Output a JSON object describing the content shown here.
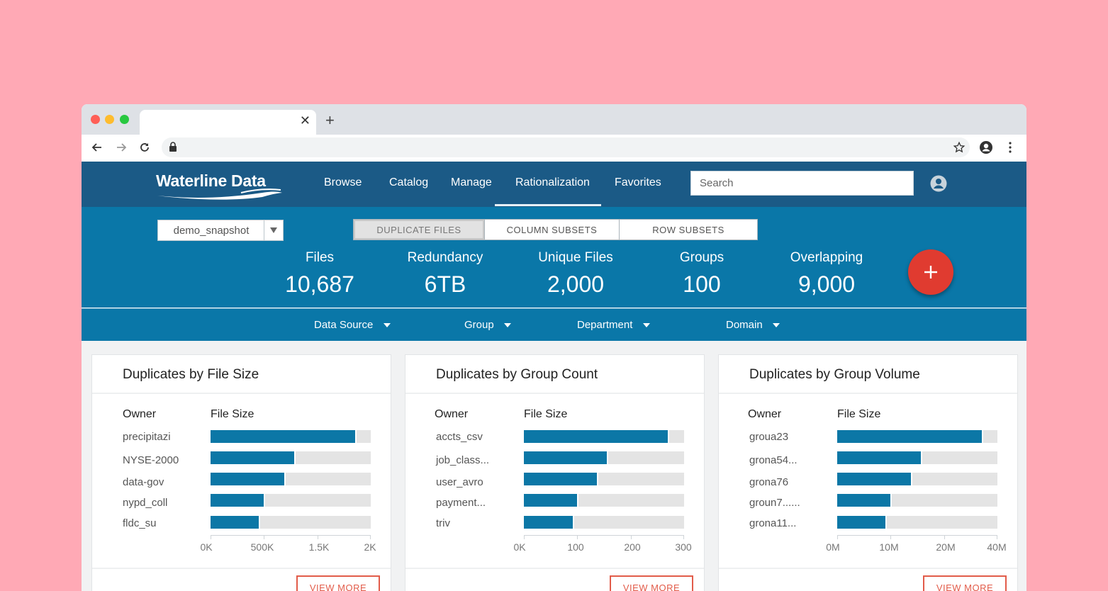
{
  "browser": {
    "tab_title": "",
    "tab_close": "✕",
    "new_tab": "+",
    "url": ""
  },
  "app": {
    "logo_text": "Waterline Data",
    "nav": [
      {
        "label": "Browse"
      },
      {
        "label": "Catalog"
      },
      {
        "label": "Manage"
      },
      {
        "label": "Rationalization",
        "active": true
      },
      {
        "label": "Favorites"
      }
    ],
    "search_placeholder": "Search"
  },
  "summary": {
    "snapshot": "demo_snapshot",
    "segments": [
      {
        "label": "DUPLICATE FILES",
        "active": true
      },
      {
        "label": "COLUMN SUBSETS"
      },
      {
        "label": "ROW SUBSETS"
      }
    ],
    "stats": [
      {
        "label": "Files",
        "value": "10,687"
      },
      {
        "label": "Redundancy",
        "value": "6TB"
      },
      {
        "label": "Unique Files",
        "value": "2,000"
      },
      {
        "label": "Groups",
        "value": "100"
      },
      {
        "label": "Overlapping",
        "value": "9,000"
      }
    ],
    "fab_label": "+"
  },
  "filters": [
    {
      "label": "Data Source"
    },
    {
      "label": "Group"
    },
    {
      "label": "Department"
    },
    {
      "label": "Domain"
    }
  ],
  "cards": [
    {
      "title": "Duplicates by File Size",
      "col_owner": "Owner",
      "col_size": "File Size",
      "rows": [
        {
          "owner": "precipitazi"
        },
        {
          "owner": "NYSE-2000"
        },
        {
          "owner": "data-gov"
        },
        {
          "owner": "nypd_coll"
        },
        {
          "owner": "fldc_su"
        }
      ],
      "ticks": [
        "0K",
        "500K",
        "1.5K",
        "2K"
      ],
      "view_more": "VIEW MORE"
    },
    {
      "title": "Duplicates by Group Count",
      "col_owner": "Owner",
      "col_size": "File Size",
      "rows": [
        {
          "owner": "accts_csv"
        },
        {
          "owner": "job_class..."
        },
        {
          "owner": "user_avro"
        },
        {
          "owner": "payment..."
        },
        {
          "owner": "triv"
        }
      ],
      "ticks": [
        "0K",
        "100",
        "200",
        "300"
      ],
      "view_more": "VIEW MORE"
    },
    {
      "title": "Duplicates by Group Volume",
      "col_owner": "Owner",
      "col_size": "File Size",
      "rows": [
        {
          "owner": "groua23"
        },
        {
          "owner": "grona54..."
        },
        {
          "owner": "grona76"
        },
        {
          "owner": "groun7......"
        },
        {
          "owner": "grona11..."
        }
      ],
      "ticks": [
        "0M",
        "10M",
        "20M",
        "40M"
      ],
      "view_more": "VIEW MORE"
    }
  ],
  "chart_data": [
    {
      "type": "bar",
      "orientation": "horizontal",
      "title": "Duplicates by File Size",
      "xlabel": "File Size",
      "ylabel": "Owner",
      "categories": [
        "precipitazi",
        "NYSE-2000",
        "data-gov",
        "nypd_coll",
        "fldc_su"
      ],
      "fractions": [
        0.91,
        0.53,
        0.47,
        0.34,
        0.31
      ],
      "tick_labels": [
        "0K",
        "500K",
        "1.5K",
        "2K"
      ]
    },
    {
      "type": "bar",
      "orientation": "horizontal",
      "title": "Duplicates by Group Count",
      "xlabel": "File Size",
      "ylabel": "Owner",
      "categories": [
        "accts_csv",
        "job_class...",
        "user_avro",
        "payment...",
        "triv"
      ],
      "values": [
        272,
        158,
        140,
        102,
        94
      ],
      "xlim": [
        0,
        300
      ],
      "tick_labels": [
        "0K",
        "100",
        "200",
        "300"
      ]
    },
    {
      "type": "bar",
      "orientation": "horizontal",
      "title": "Duplicates by Group Volume",
      "xlabel": "File Size",
      "ylabel": "Owner",
      "categories": [
        "groua23",
        "grona54...",
        "grona76",
        "groun7......",
        "grona11..."
      ],
      "fractions": [
        0.91,
        0.53,
        0.47,
        0.34,
        0.31
      ],
      "tick_labels": [
        "0M",
        "10M",
        "20M",
        "40M"
      ]
    }
  ],
  "colors": {
    "page_bg": "#ffa9b5",
    "nav_bg": "#1b5a86",
    "band_bg": "#0a77a8",
    "bar": "#0c77a6",
    "bar_track": "#e4e4e4",
    "fab": "#e03b30",
    "view_more": "#e25c4a"
  },
  "icons": {
    "back": "arrow-left-icon",
    "forward": "arrow-right-icon",
    "reload": "reload-icon",
    "lock": "lock-icon",
    "bookmark": "star-icon",
    "profile": "account-circle-icon",
    "menu": "kebab-menu-icon",
    "user": "user-icon",
    "dropdown": "caret-down-icon",
    "add": "plus-icon"
  }
}
